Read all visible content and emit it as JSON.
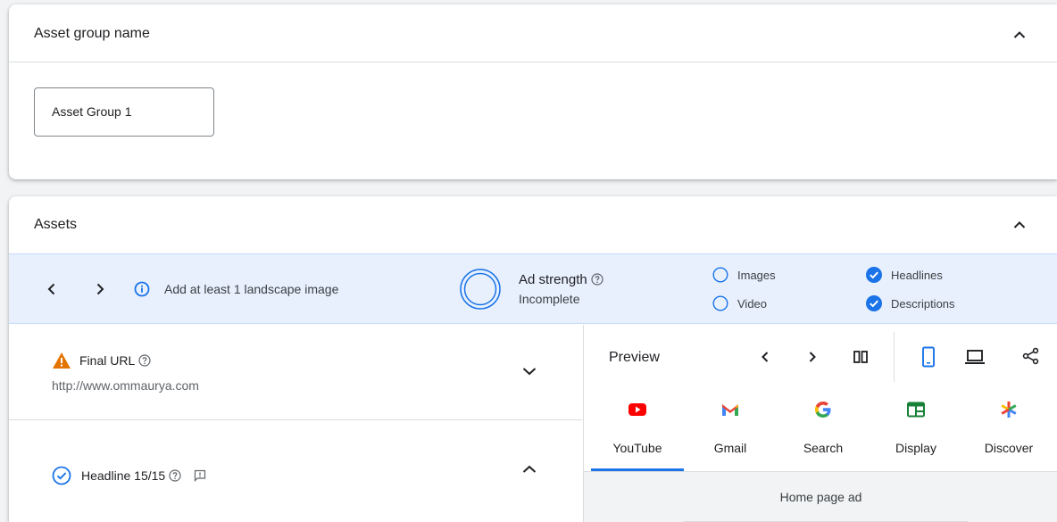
{
  "asset_group_card": {
    "title": "Asset group name",
    "name_value": "Asset Group 1"
  },
  "assets_card": {
    "title": "Assets",
    "strength_bar": {
      "tip": "Add at least 1 landscape image",
      "strength_label": "Ad strength",
      "strength_value": "Incomplete",
      "checks": [
        {
          "label": "Images",
          "done": false
        },
        {
          "label": "Video",
          "done": false
        },
        {
          "label": "Headlines",
          "done": true
        },
        {
          "label": "Descriptions",
          "done": true
        }
      ]
    },
    "final_url": {
      "title": "Final URL",
      "url": "http://www.ommaurya.com"
    },
    "headline": {
      "title": "Headline 15/15"
    },
    "preview": {
      "title": "Preview",
      "tabs": [
        {
          "label": "YouTube",
          "icon": "youtube-icon",
          "active": true
        },
        {
          "label": "Gmail",
          "icon": "gmail-icon",
          "active": false
        },
        {
          "label": "Search",
          "icon": "google-icon",
          "active": false
        },
        {
          "label": "Display",
          "icon": "display-icon",
          "active": false
        },
        {
          "label": "Discover",
          "icon": "discover-icon",
          "active": false
        }
      ],
      "ad_type": "Home page ad"
    }
  },
  "colors": {
    "accent": "#1a73e8",
    "warning": "#e37400",
    "info_bar": "#e8f0fe",
    "youtube_red": "#ff0000",
    "display_green": "#188038"
  }
}
